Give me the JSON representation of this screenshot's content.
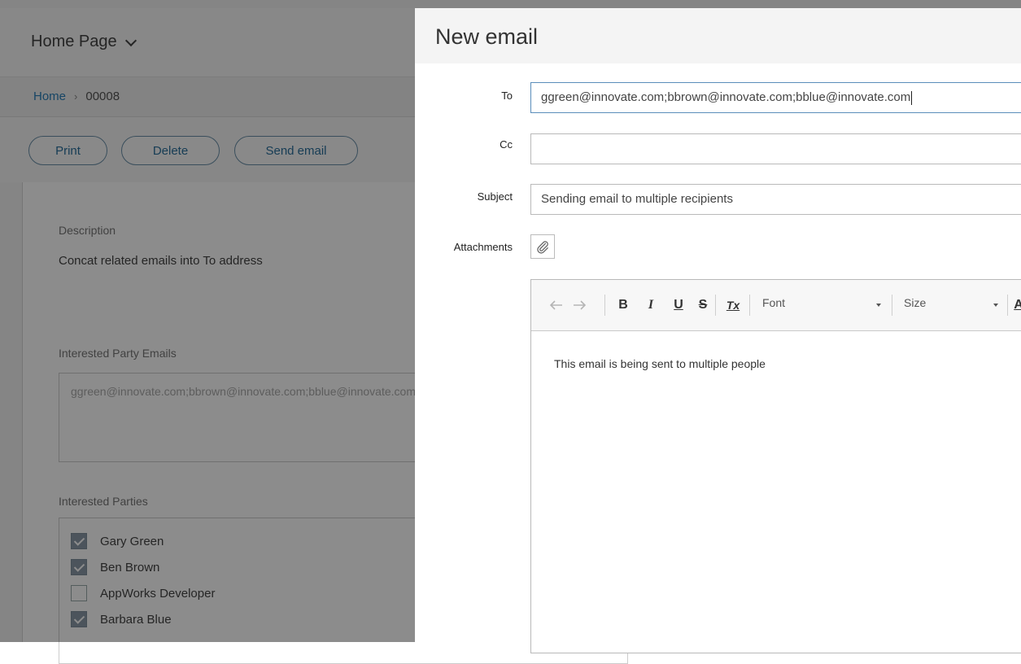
{
  "background": {
    "header": {
      "title": "Home Page"
    },
    "breadcrumb": {
      "home": "Home",
      "separator": "›",
      "current": "00008"
    },
    "actions": {
      "print": "Print",
      "delete": "Delete",
      "send_email": "Send email"
    },
    "description": {
      "label": "Description",
      "value": "Concat related emails into To address"
    },
    "interested_party_emails": {
      "label": "Interested Party Emails",
      "value": "ggreen@innovate.com;bbrown@innovate.com;bblue@innovate.com"
    },
    "interested_parties": {
      "label": "Interested Parties",
      "items": [
        {
          "name": "Gary Green",
          "checked": true
        },
        {
          "name": "Ben Brown",
          "checked": true
        },
        {
          "name": "AppWorks Developer",
          "checked": false
        },
        {
          "name": "Barbara Blue",
          "checked": true
        }
      ]
    }
  },
  "dialog": {
    "title": "New email",
    "to": {
      "label": "To",
      "value": "ggreen@innovate.com;bbrown@innovate.com;bblue@innovate.com"
    },
    "cc": {
      "label": "Cc",
      "value": ""
    },
    "subject": {
      "label": "Subject",
      "value": "Sending email to multiple recipients"
    },
    "attachments": {
      "label": "Attachments",
      "icon": "paperclip-icon"
    },
    "editor": {
      "toolbar": {
        "undo_icon": "undo-icon",
        "redo_icon": "redo-icon",
        "bold": "B",
        "italic": "I",
        "underline": "U",
        "strike": "S",
        "clear_format": "Tx",
        "font": "Font",
        "size": "Size",
        "more": "A"
      },
      "body": "This email is being sent to multiple people"
    }
  }
}
